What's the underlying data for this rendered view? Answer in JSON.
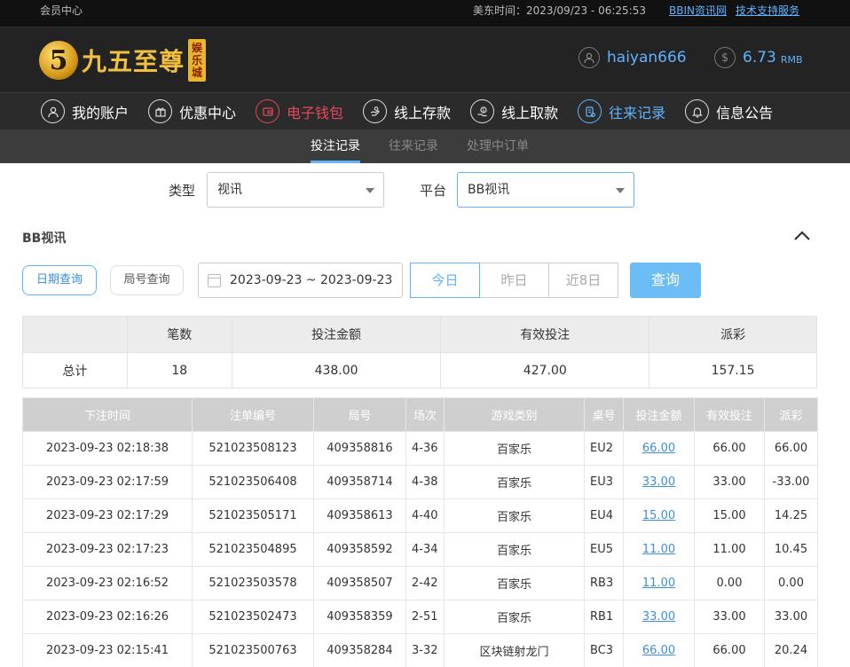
{
  "topbar": {
    "member_center": "会员中心",
    "time": "美东时间：2023/09/23 - 06:25:53",
    "links": [
      "BBIN资讯网",
      "技术支持服务"
    ]
  },
  "header": {
    "logo_char": "5",
    "logo_text": "九五至尊",
    "logo_badge": [
      "娱",
      "乐",
      "城"
    ],
    "username": "haiyan666",
    "balance": "6.73",
    "currency": "RMB"
  },
  "mainnav": {
    "items": [
      {
        "label": "我的账户",
        "icon": "user-icon"
      },
      {
        "label": "优惠中心",
        "icon": "gift-icon"
      },
      {
        "label": "电子钱包",
        "icon": "wallet-icon"
      },
      {
        "label": "线上存款",
        "icon": "deposit-icon"
      },
      {
        "label": "线上取款",
        "icon": "withdraw-icon"
      },
      {
        "label": "往来记录",
        "icon": "records-icon"
      },
      {
        "label": "信息公告",
        "icon": "bell-icon"
      }
    ]
  },
  "subnav": {
    "tabs": [
      "投注记录",
      "往来记录",
      "处理中订单"
    ]
  },
  "filter": {
    "type_label": "类型",
    "type_value": "视讯",
    "platform_label": "平台",
    "platform_value": "BB视讯"
  },
  "section_title": "BB视讯",
  "query": {
    "date_query": "日期查询",
    "round_query": "局号查询",
    "date_range": "2023-09-23 ~ 2023-09-23",
    "ranges": [
      "今日",
      "昨日",
      "近8日"
    ],
    "search": "查询"
  },
  "summary": {
    "headers": [
      "",
      "笔数",
      "投注金额",
      "有效投注",
      "派彩"
    ],
    "row": [
      "总计",
      "18",
      "438.00",
      "427.00",
      "157.15"
    ]
  },
  "details": {
    "headers": [
      "下注时间",
      "注单编号",
      "局号",
      "场次",
      "游戏类别",
      "桌号",
      "投注金额",
      "有效投注",
      "派彩"
    ],
    "rows": [
      [
        "2023-09-23 02:18:38",
        "521023508123",
        "409358816",
        "4-36",
        "百家乐",
        "EU2",
        "66.00",
        "66.00",
        "66.00"
      ],
      [
        "2023-09-23 02:17:59",
        "521023506408",
        "409358714",
        "4-38",
        "百家乐",
        "EU3",
        "33.00",
        "33.00",
        "-33.00"
      ],
      [
        "2023-09-23 02:17:29",
        "521023505171",
        "409358613",
        "4-40",
        "百家乐",
        "EU4",
        "15.00",
        "15.00",
        "14.25"
      ],
      [
        "2023-09-23 02:17:23",
        "521023504895",
        "409358592",
        "4-34",
        "百家乐",
        "EU5",
        "11.00",
        "11.00",
        "10.45"
      ],
      [
        "2023-09-23 02:16:52",
        "521023503578",
        "409358507",
        "2-42",
        "百家乐",
        "RB3",
        "11.00",
        "0.00",
        "0.00"
      ],
      [
        "2023-09-23 02:16:26",
        "521023502473",
        "409358359",
        "2-51",
        "百家乐",
        "RB1",
        "33.00",
        "33.00",
        "33.00"
      ],
      [
        "2023-09-23 02:15:41",
        "521023500763",
        "409358284",
        "3-32",
        "区块链射龙门",
        "BC3",
        "66.00",
        "66.00",
        "20.24"
      ]
    ]
  }
}
